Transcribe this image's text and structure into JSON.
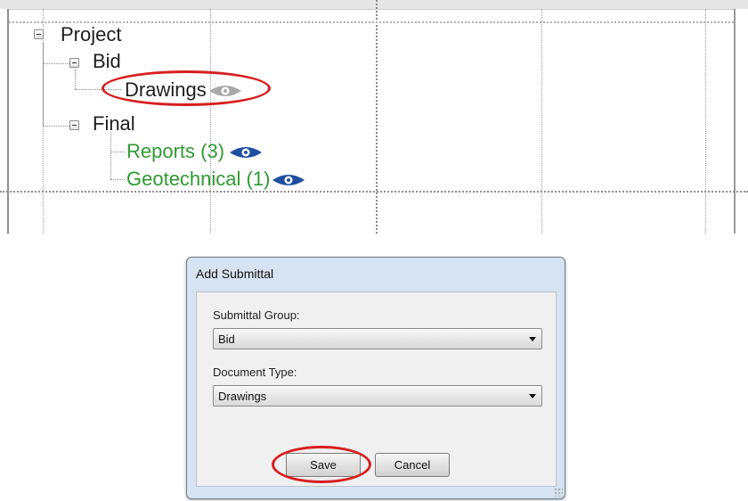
{
  "tree": {
    "nodes": [
      {
        "label": "Project",
        "status": "none"
      },
      {
        "label": "Bid",
        "status": "none"
      },
      {
        "label": "Drawings",
        "status": "not-viewed"
      },
      {
        "label": "Final",
        "status": "none"
      },
      {
        "label": "Reports (3)",
        "status": "viewed"
      },
      {
        "label": "Geotechnical (1)",
        "status": "viewed"
      }
    ],
    "icons": {
      "collapse": "minus-box-icon",
      "view": "eye-icon"
    },
    "colors": {
      "completed_text": "#2f9a2f",
      "eye_active": "#1f4fa0",
      "eye_inactive": "#a9a9a9",
      "highlight": "#d81e1e"
    }
  },
  "dialog": {
    "title": "Add Submittal",
    "submittal_group_label": "Submittal Group:",
    "submittal_group_value": "Bid",
    "document_type_label": "Document Type:",
    "document_type_value": "Drawings",
    "save_label": "Save",
    "cancel_label": "Cancel",
    "icons": {
      "dropdown": "chevron-down-icon",
      "resize": "resize-grip-icon"
    }
  }
}
